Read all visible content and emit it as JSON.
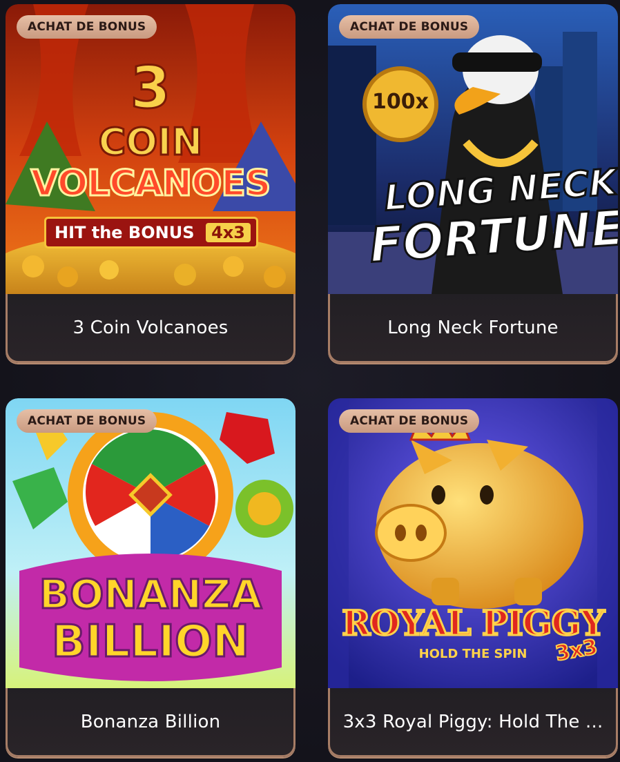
{
  "games": [
    {
      "badge": "ACHAT DE BONUS",
      "title": "3 Coin Volcanoes",
      "art": {
        "line1": "3",
        "line2": "COIN",
        "line3": "VOLCANOES",
        "line4": "HIT the BONUS",
        "line4b": "4x3"
      }
    },
    {
      "badge": "ACHAT DE BONUS",
      "title": "Long Neck Fortune",
      "art": {
        "coin": "100x",
        "line1": "LONG NECK",
        "line2": "FORTUNE"
      }
    },
    {
      "badge": "ACHAT DE BONUS",
      "title": "Bonanza Billion",
      "art": {
        "line1": "BONANZA",
        "line2": "BILLION"
      }
    },
    {
      "badge": "ACHAT DE BONUS",
      "title": "3x3 Royal Piggy: Hold The ...",
      "art": {
        "line1": "ROYAL PIGGY",
        "line2": "HOLD THE SPIN",
        "line3": "3x3"
      }
    }
  ],
  "colors": {
    "badge_bg": "#d9ad93",
    "card_border": "#a77d66",
    "page_bg": "#17161f"
  }
}
